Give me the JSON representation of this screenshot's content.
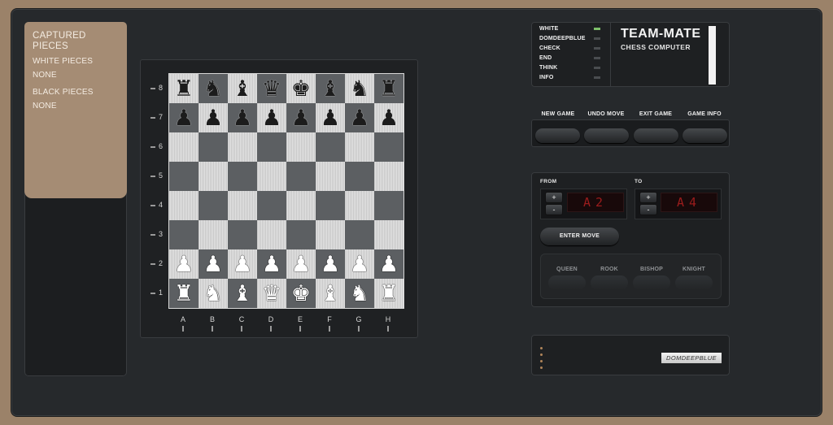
{
  "captured": {
    "title": "CAPTURED PIECES",
    "white_label": "WHITE PIECES",
    "white_value": "NONE",
    "black_label": "BLACK PIECES",
    "black_value": "NONE"
  },
  "board": {
    "ranks": [
      "8",
      "7",
      "6",
      "5",
      "4",
      "3",
      "2",
      "1"
    ],
    "files": [
      "A",
      "B",
      "C",
      "D",
      "E",
      "F",
      "G",
      "H"
    ],
    "rows": [
      [
        "br",
        "bn",
        "bb",
        "bq",
        "bk",
        "bb",
        "bn",
        "br"
      ],
      [
        "bp",
        "bp",
        "bp",
        "bp",
        "bp",
        "bp",
        "bp",
        "bp"
      ],
      [
        "",
        "",
        "",
        "",
        "",
        "",
        "",
        ""
      ],
      [
        "",
        "",
        "",
        "",
        "",
        "",
        "",
        ""
      ],
      [
        "",
        "",
        "",
        "",
        "",
        "",
        "",
        ""
      ],
      [
        "",
        "",
        "",
        "",
        "",
        "",
        "",
        ""
      ],
      [
        "wp",
        "wp",
        "wp",
        "wp",
        "wp",
        "wp",
        "wp",
        "wp"
      ],
      [
        "wr",
        "wn",
        "wb",
        "wq",
        "wk",
        "wb",
        "wn",
        "wr"
      ]
    ],
    "light_color": "#d8d8d8",
    "dark_color": "#5c5f62"
  },
  "status": {
    "indicators": [
      {
        "label": "WHITE",
        "on": true
      },
      {
        "label": "DOMDEEPBLUE",
        "on": false
      },
      {
        "label": "CHECK",
        "on": false
      },
      {
        "label": "END",
        "on": false
      },
      {
        "label": "THINK",
        "on": false
      },
      {
        "label": "INFO",
        "on": false
      }
    ],
    "led_on_color": "#7ec06a",
    "brand_title": "TEAM-MATE",
    "brand_subtitle": "CHESS COMPUTER"
  },
  "commands": {
    "new_game": "NEW GAME",
    "undo_move": "UNDO MOVE",
    "exit_game": "EXIT GAME",
    "game_info": "GAME INFO"
  },
  "move": {
    "from_label": "FROM",
    "to_label": "TO",
    "from_value": "A2",
    "to_value": "A4",
    "plus": "+",
    "minus": "-",
    "enter_label": "ENTER MOVE",
    "promotion": [
      "QUEEN",
      "ROOK",
      "BISHOP",
      "KNIGHT"
    ],
    "display_color": "#9b1c1c"
  },
  "footer": {
    "badge": "DOMDEEPBLUE"
  }
}
